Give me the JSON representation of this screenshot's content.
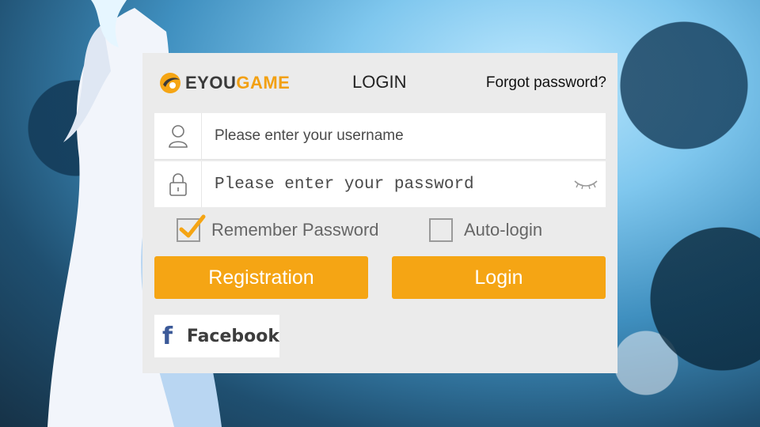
{
  "brand": {
    "logo_eyou": "EYOU",
    "logo_game": "GAME",
    "accent_color": "#f5a514",
    "facebook_color": "#3b5998"
  },
  "header": {
    "title": "LOGIN",
    "forgot_link": "Forgot password?"
  },
  "form": {
    "username": {
      "value": "",
      "placeholder": "Please enter your username",
      "icon": "user-icon"
    },
    "password": {
      "value": "",
      "placeholder": "Please enter your password",
      "icon": "lock-icon",
      "toggle_icon": "eye-closed-icon"
    },
    "remember": {
      "label": "Remember Password",
      "checked": true
    },
    "auto_login": {
      "label": "Auto-login",
      "checked": false
    }
  },
  "buttons": {
    "registration": "Registration",
    "login": "Login"
  },
  "social": {
    "facebook_glyph": "f",
    "facebook_label": "Facebook"
  }
}
